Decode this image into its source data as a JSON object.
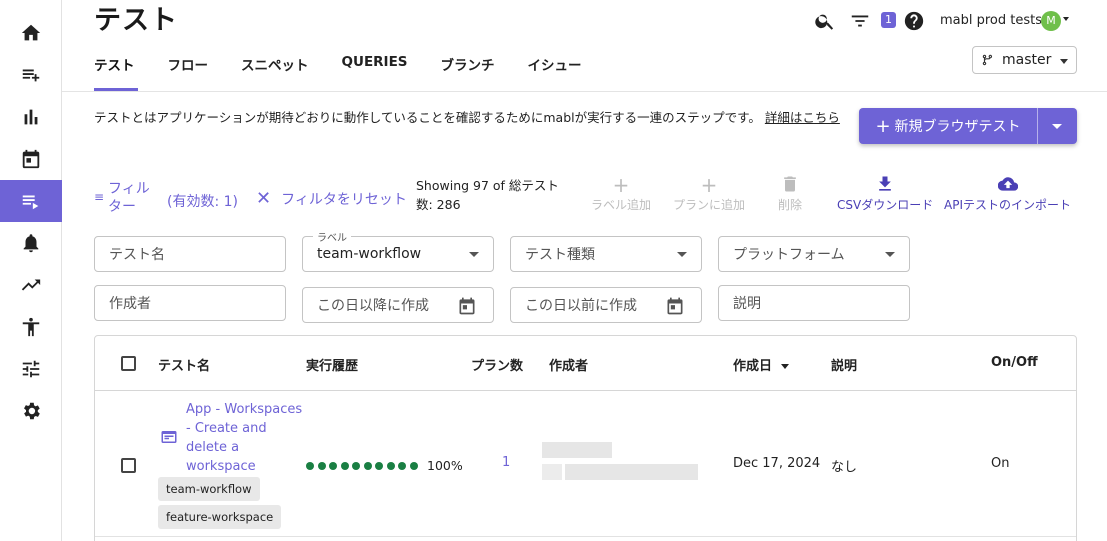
{
  "header": {
    "title": "テスト",
    "notification_count": "1",
    "user_name": "mabl prod tests",
    "avatar_initial": "M",
    "branch": "master"
  },
  "tabs": [
    "テスト",
    "フロー",
    "スニペット",
    "QUERIES",
    "ブランチ",
    "イシュー"
  ],
  "description": {
    "text": "テストとはアプリケーションが期待どおりに動作していることを確認するためにmablが実行する一連のステップです。",
    "link": "詳細はこちら"
  },
  "new_button": {
    "label": "新規ブラウザテスト"
  },
  "filter_bar": {
    "filter_label": "フィルター",
    "active_count": "(有効数: 1)",
    "reset_label": "フィルタをリセット",
    "showing": "Showing 97 of 総テスト数: 286",
    "actions": [
      "ラベル追加",
      "プランに追加",
      "削除",
      "CSVダウンロード",
      "APIテストのインポート"
    ]
  },
  "filters": {
    "test_name_placeholder": "テスト名",
    "label_caption": "ラベル",
    "label_value": "team-workflow",
    "test_type_placeholder": "テスト種類",
    "platform_placeholder": "プラットフォーム",
    "creator_placeholder": "作成者",
    "created_after_placeholder": "この日以降に作成",
    "created_before_placeholder": "この日以前に作成",
    "description_placeholder": "説明"
  },
  "table": {
    "columns": [
      "テスト名",
      "実行履歴",
      "プラン数",
      "作成者",
      "作成日",
      "説明",
      "On/Off"
    ],
    "rows": [
      {
        "name": "App - Workspaces - Create and delete a workspace",
        "labels": [
          "team-workflow",
          "feature-workspace"
        ],
        "run_history_pct": "100%",
        "plan_count": "1",
        "created": "Dec 17, 2024",
        "description": "なし",
        "on_off": "On"
      }
    ]
  },
  "colors": {
    "accent": "#6e63d6",
    "success": "#1a7f43"
  }
}
